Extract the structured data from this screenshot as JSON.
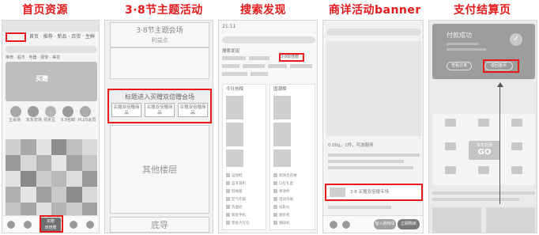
{
  "titles": {
    "home": "首页资源",
    "theme": "3·8节主题活动",
    "search": "搜索发现",
    "detail": "商详活动banner",
    "pay": "支付结算页"
  },
  "home": {
    "tabs": [
      "首页",
      "推荐",
      "新品",
      "百货",
      "生鲜"
    ],
    "promo_title": "买赠",
    "icons": [
      "主会场",
      "东东农场",
      "领京豆",
      "9.9包邮",
      "PLUS会员"
    ],
    "badge": [
      "买赠",
      "双倍赠"
    ]
  },
  "theme": {
    "head_title": "3·8节主题会场",
    "head_sub": "利益点",
    "promo_title": "标题进入买赠双倍赠会场",
    "product_label": "买赠双倍赠商品",
    "floors": "其他楼层",
    "bottom": "底导"
  },
  "search": {
    "time": "21:11",
    "section": "搜索发现",
    "highlight": "3·8双倍赠",
    "tabs": [
      "今日热榜",
      "国潮榜"
    ],
    "list_left": [
      "运动鞋",
      "蓝牙耳机",
      "羽绒服",
      "空气炸锅",
      "洗面奶",
      "新款手机",
      "零食大礼包"
    ],
    "list_right": [
      "新款连衣裙",
      "口红礼盒",
      "保温杯",
      "电动牙刷",
      "投影仪",
      "跑步机",
      "咖啡机"
    ]
  },
  "detail": {
    "price": "0.00g，1件，可选服务",
    "banner": "3·8 买赠双倍赠专场",
    "buttons": [
      "加入购物车",
      "立即购买"
    ]
  },
  "pay": {
    "status": "付款成功",
    "buttons": [
      "查看订单",
      "返回首页"
    ],
    "go_top": "东东农场",
    "go": "GO"
  }
}
